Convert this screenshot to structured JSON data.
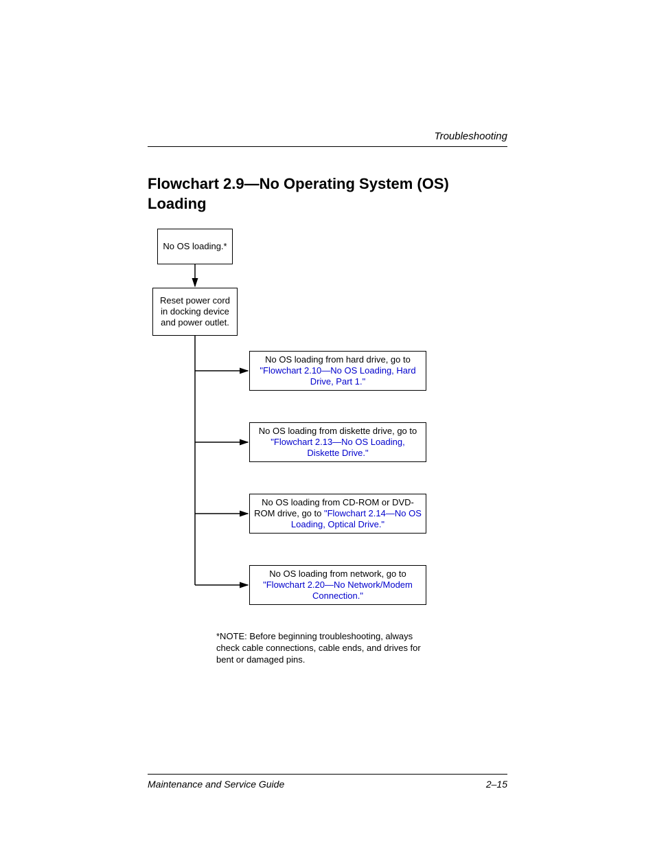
{
  "header": {
    "section": "Troubleshooting"
  },
  "title": "Flowchart 2.9—No Operating System (OS) Loading",
  "flow": {
    "start": "No OS loading.*",
    "reset": "Reset power cord in docking device and power outlet.",
    "branches": {
      "hdd": {
        "prefix": "No OS loading from hard drive, go to ",
        "link": "\"Flowchart 2.10—No OS Loading, Hard Drive, Part 1.\""
      },
      "diskette": {
        "prefix": "No OS loading from diskette drive, go to ",
        "link": "\"Flowchart 2.13—No OS Loading, Diskette Drive.\""
      },
      "cdrom": {
        "prefix": "No OS loading from CD-ROM or DVD-ROM drive, go to ",
        "link": "\"Flowchart 2.14—No OS Loading, Optical Drive.\""
      },
      "network": {
        "prefix": "No OS loading from network, go to ",
        "link": "\"Flowchart 2.20—No Network/Modem Connection.\""
      }
    },
    "note": "*NOTE: Before beginning troubleshooting, always check cable connections, cable ends, and drives for bent or damaged pins."
  },
  "footer": {
    "left": "Maintenance and Service Guide",
    "right": "2–15"
  }
}
